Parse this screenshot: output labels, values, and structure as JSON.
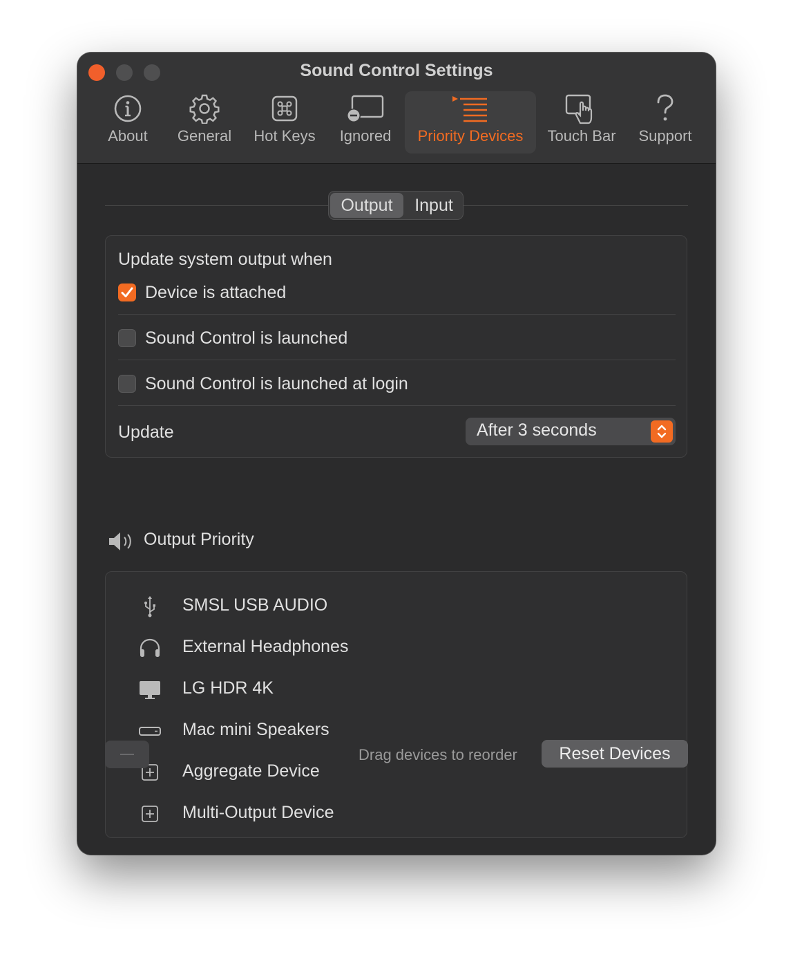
{
  "window": {
    "title": "Sound Control Settings"
  },
  "toolbar": {
    "items": [
      {
        "label": "About",
        "icon": "info-icon"
      },
      {
        "label": "General",
        "icon": "gear-icon"
      },
      {
        "label": "Hot Keys",
        "icon": "command-key-icon"
      },
      {
        "label": "Ignored",
        "icon": "ignored-display-icon"
      },
      {
        "label": "Priority Devices",
        "icon": "priority-list-icon",
        "selected": true
      },
      {
        "label": "Touch Bar",
        "icon": "touch-bar-hand-icon"
      },
      {
        "label": "Support",
        "icon": "question-mark-icon"
      }
    ]
  },
  "segmented": {
    "output": "Output",
    "input": "Input",
    "selected": "Output"
  },
  "settings": {
    "heading": "Update system output when",
    "options": [
      {
        "label": "Device is attached",
        "checked": true
      },
      {
        "label": "Sound Control is launched",
        "checked": false
      },
      {
        "label": "Sound Control is launched at login",
        "checked": false
      }
    ],
    "update_label": "Update",
    "update_value": "After 3 seconds"
  },
  "priority": {
    "title": "Output Priority",
    "icon": "speaker-icon",
    "devices": [
      {
        "name": "SMSL USB AUDIO",
        "icon": "usb-icon"
      },
      {
        "name": "External Headphones",
        "icon": "headphones-icon"
      },
      {
        "name": "LG HDR 4K",
        "icon": "display-icon"
      },
      {
        "name": "Mac mini Speakers",
        "icon": "mac-mini-icon"
      },
      {
        "name": "Aggregate Device",
        "icon": "aggregate-device-icon"
      },
      {
        "name": "Multi-Output Device",
        "icon": "multi-output-device-icon"
      }
    ]
  },
  "footer": {
    "minus": "—",
    "hint": "Drag devices to reorder",
    "reset": "Reset Devices"
  },
  "colors": {
    "accent": "#f26b22",
    "window_bg": "#2b2b2c",
    "text": "#e0e0e0"
  }
}
